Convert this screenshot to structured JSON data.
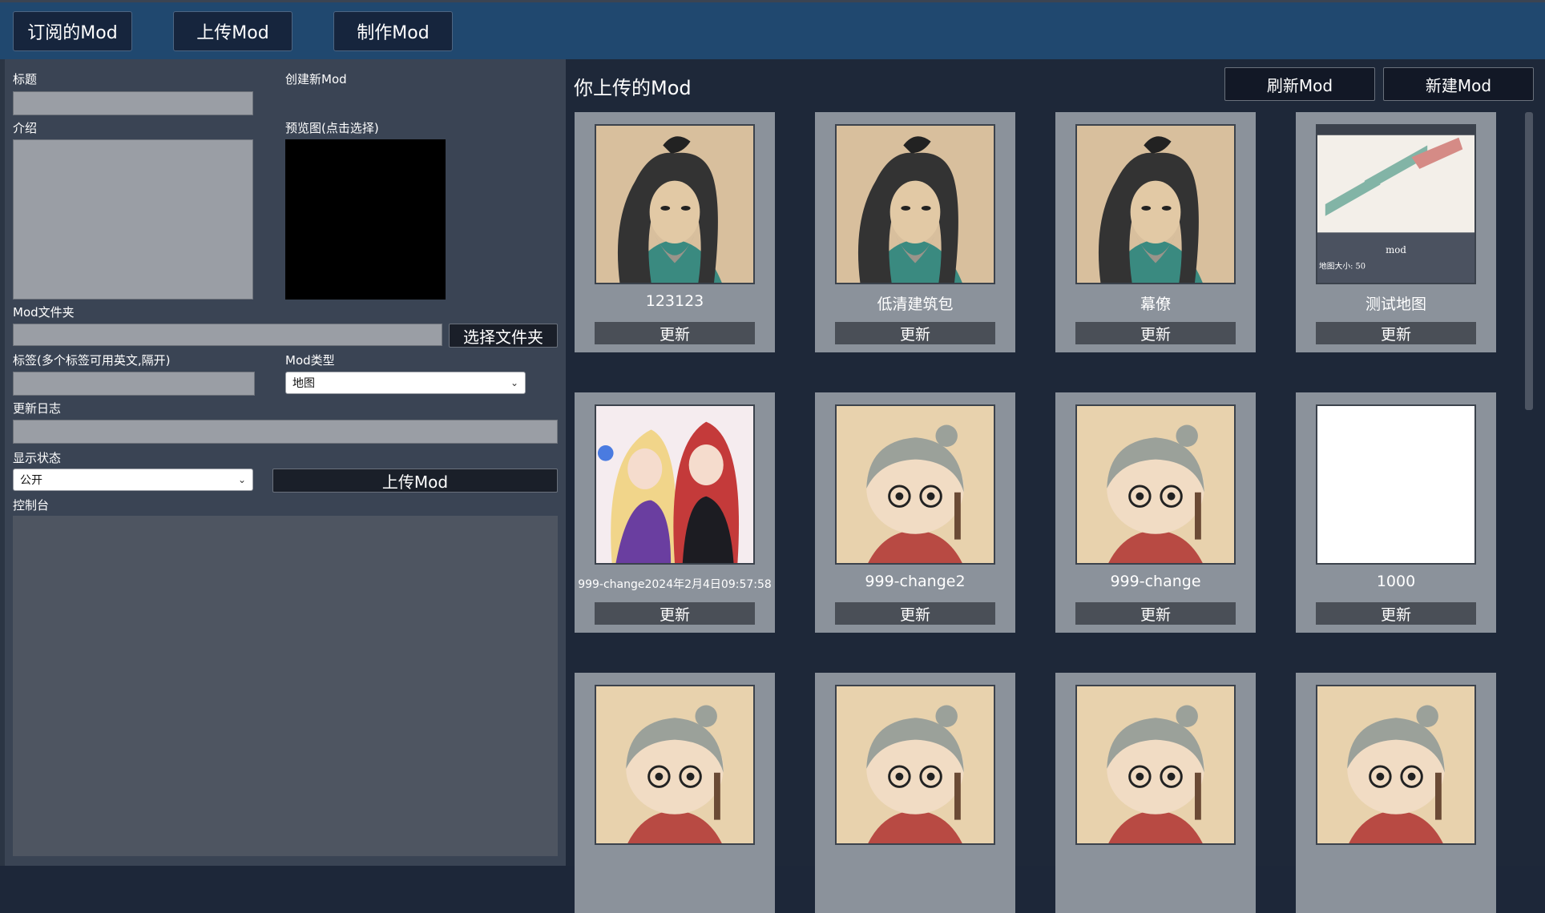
{
  "tabs": [
    {
      "label": "订阅的Mod"
    },
    {
      "label": "上传Mod"
    },
    {
      "label": "制作Mod"
    }
  ],
  "form": {
    "title_label": "标题",
    "create_label": "创建新Mod",
    "intro_label": "介绍",
    "preview_label": "预览图(点击选择)",
    "folder_label": "Mod文件夹",
    "choose_folder_button": "选择文件夹",
    "tags_label": "标签(多个标签可用英文,隔开)",
    "type_label": "Mod类型",
    "type_value": "地图",
    "changelog_label": "更新日志",
    "visibility_label": "显示状态",
    "visibility_value": "公开",
    "upload_button": "上传Mod",
    "console_label": "控制台"
  },
  "uploaded": {
    "title": "你上传的Mod",
    "refresh_button": "刷新Mod",
    "new_button": "新建Mod",
    "map_preview_caption": "mod",
    "map_preview_size": "地图大小: 50",
    "map_preview_logo": "mod",
    "cards": [
      {
        "name": "123123",
        "update": "更新",
        "image": "scholar-portrait"
      },
      {
        "name": "低清建筑包",
        "update": "更新",
        "image": "scholar-portrait"
      },
      {
        "name": "幕僚",
        "update": "更新",
        "image": "scholar-portrait"
      },
      {
        "name": "测试地图",
        "update": "更新",
        "image": "map-preview"
      },
      {
        "name": "999-change2024年2月4日09:57:58",
        "update": "更新",
        "image": "anime-girls"
      },
      {
        "name": "999-change2",
        "update": "更新",
        "image": "chibi-boy"
      },
      {
        "name": "999-change",
        "update": "更新",
        "image": "chibi-boy"
      },
      {
        "name": "1000",
        "update": "更新",
        "image": "blank-white"
      },
      {
        "name": "",
        "update": "",
        "image": "chibi-boy"
      },
      {
        "name": "",
        "update": "",
        "image": "chibi-boy"
      },
      {
        "name": "",
        "update": "",
        "image": "chibi-boy"
      },
      {
        "name": "",
        "update": "",
        "image": "chibi-boy"
      }
    ]
  },
  "colors": {
    "topbar": "#20486f",
    "left_panel": "#3a4454",
    "right_panel": "#1e2839",
    "card": "#8b929b",
    "card_button": "#4a4f57"
  }
}
